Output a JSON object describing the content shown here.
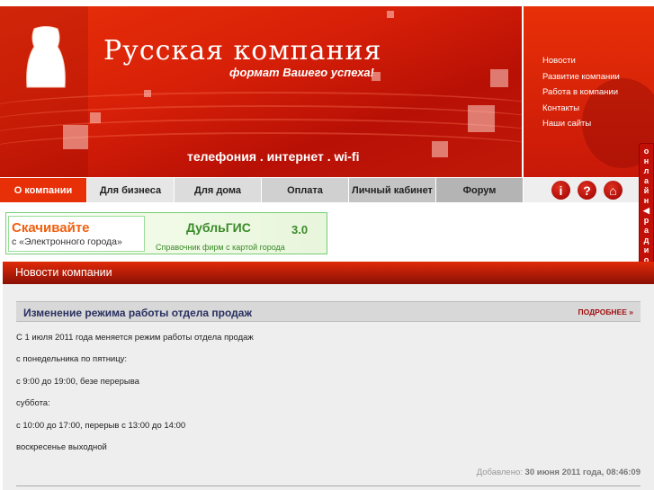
{
  "header": {
    "company": "Русская компания",
    "slogan": "формат Вашего успеха!",
    "services": "телефония . интернет . wi-fi"
  },
  "top_links": [
    "Новости",
    "Развитие компании",
    "Работа в компании",
    "Контакты",
    "Наши сайты"
  ],
  "nav": [
    "О компании",
    "Для бизнеса",
    "Для дома",
    "Оплата",
    "Личный кабинет",
    "Форум"
  ],
  "icons": {
    "info": "i",
    "help": "?",
    "home": "⌂"
  },
  "ad": {
    "line1": "Скачивайте",
    "line2": "с «Электронного города»",
    "brand": "ДубльГИС",
    "version": "3.0",
    "caption": "Справочник фирм с картой города"
  },
  "radio": {
    "label1": "онлайн",
    "label2": "радио"
  },
  "section": {
    "title": "Новости компании"
  },
  "news": {
    "title": "Изменение режима работы отдела продаж",
    "more": "ПОДРОБНЕЕ »",
    "lines": [
      "С 1 июля 2011 года меняется режим работы отдела продаж",
      "с понедельника по пятницу:",
      "с 9:00 до 19:00, безе перерыва",
      "суббота:",
      "с 10:00 до 17:00, перерыв с 13:00 до 14:00",
      "воскресенье выходной"
    ],
    "added_label": "Добавлено:",
    "added_value": "30 июня 2011 года, 08:46:09"
  }
}
